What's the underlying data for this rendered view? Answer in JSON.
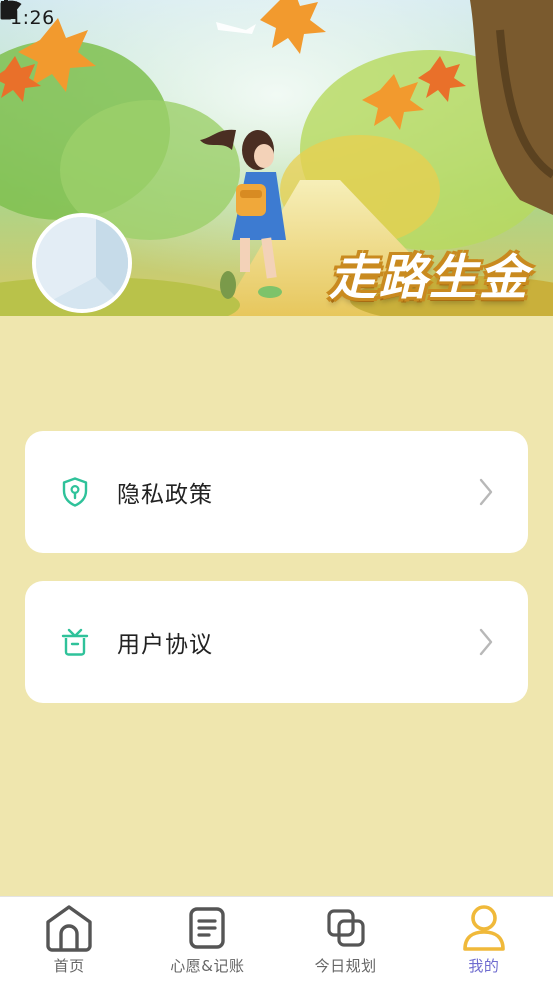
{
  "status_bar": {
    "time": "1:26",
    "icons_left": [
      "download-icon",
      "a-badge-icon"
    ],
    "icons_right": [
      "wifi-icon",
      "signal-icon",
      "battery-icon"
    ]
  },
  "header": {
    "slogan": "走路生金"
  },
  "menu": {
    "items": [
      {
        "label": "隐私政策",
        "icon": "shield-keyhole-icon",
        "accent": "#2fc29a"
      },
      {
        "label": "用户协议",
        "icon": "gift-box-icon",
        "accent": "#2fc29a"
      }
    ]
  },
  "tabs": {
    "active_color": "#6f6ccf",
    "inactive_color": "#666666",
    "items": [
      {
        "label": "首页",
        "icon": "home-icon"
      },
      {
        "label": "心愿&记账",
        "icon": "notes-icon"
      },
      {
        "label": "今日规划",
        "icon": "plan-icon"
      },
      {
        "label": "我的",
        "icon": "person-icon"
      }
    ]
  },
  "colors": {
    "page_background": "#efe6ae",
    "card_background": "#ffffff",
    "profile_icon_color": "#f0b93a"
  }
}
